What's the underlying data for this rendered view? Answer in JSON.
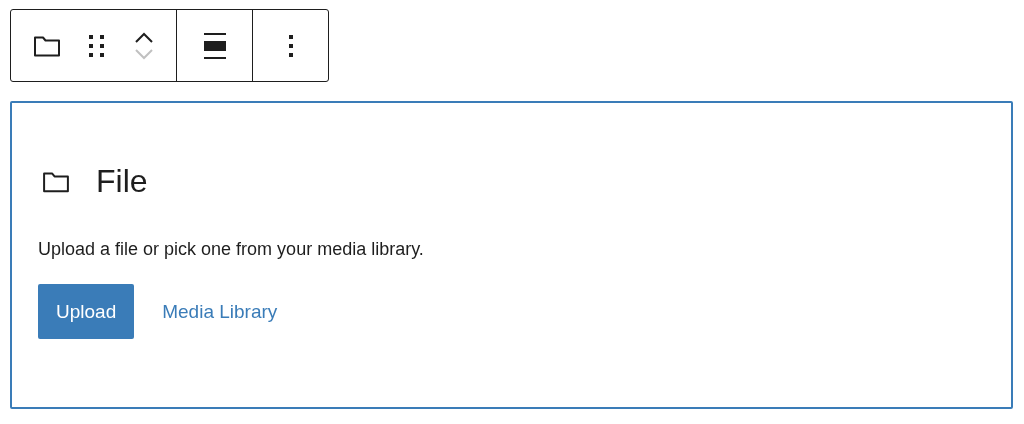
{
  "toolbar": {
    "move_up": {
      "disabled": false
    },
    "move_down": {
      "disabled": true
    }
  },
  "block": {
    "title": "File",
    "instructions": "Upload a file or pick one from your media library.",
    "upload_button": "Upload",
    "media_library_link": "Media Library"
  }
}
